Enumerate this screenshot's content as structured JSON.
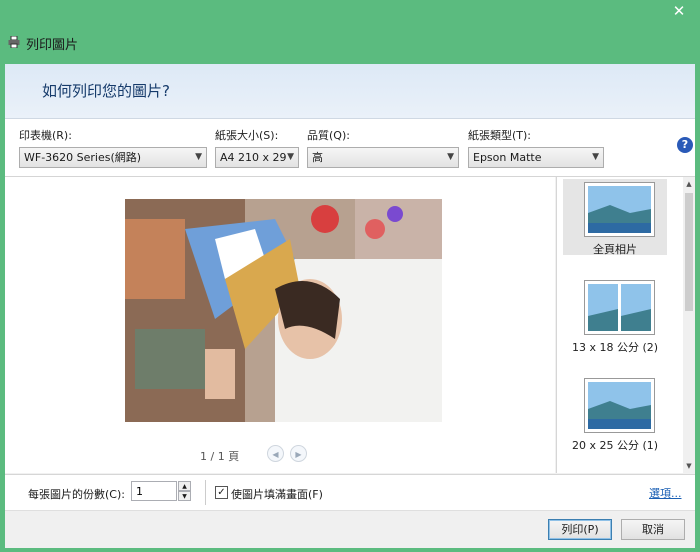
{
  "window": {
    "title": "列印圖片",
    "close": "✕"
  },
  "header": {
    "heading": "如何列印您的圖片?"
  },
  "settings": {
    "printer": {
      "label": "印表機(R):",
      "value": "WF-3620 Series(網路)"
    },
    "paper_size": {
      "label": "紙張大小(S):",
      "value": "A4 210 x 29"
    },
    "quality": {
      "label": "品質(Q):",
      "value": "高"
    },
    "paper_type": {
      "label": "紙張類型(T):",
      "value": "Epson Matte"
    },
    "help": "?"
  },
  "preview": {
    "page_indicator": "1 / 1 頁"
  },
  "layouts": [
    {
      "label": "全頁相片"
    },
    {
      "label": "13 x 18 公分 (2)"
    },
    {
      "label": "20 x 25 公分 (1)"
    }
  ],
  "options": {
    "copies_label": "每張圖片的份數(C):",
    "copies_value": "1",
    "fit_label": "使圖片填滿畫面(F)",
    "fit_checked": true,
    "options_link": "選項..."
  },
  "footer": {
    "print_label": "列印(P)",
    "cancel_label": "取消"
  },
  "icons": [
    "printer-icon",
    "close-icon",
    "help-icon",
    "dropdown-arrow-icon",
    "prev-page-icon",
    "next-page-icon",
    "checkmark-icon"
  ]
}
